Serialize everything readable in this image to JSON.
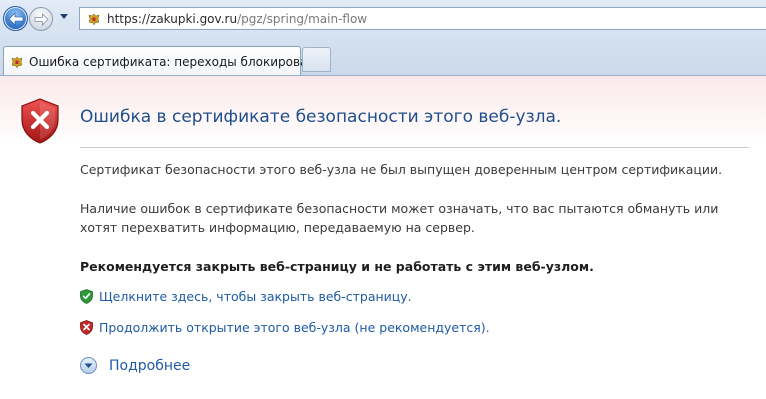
{
  "browser": {
    "url": {
      "host": "https://zakupki.gov.ru",
      "path": "/pgz/spring/main-flow"
    },
    "tab": {
      "label": "Ошибка сертификата: переходы блокированы"
    },
    "icons": {
      "back": "back-arrow-icon",
      "forward": "forward-arrow-icon",
      "dropdown": "chevron-down-icon",
      "favicon": "coat-of-arms-icon"
    }
  },
  "page": {
    "title": "Ошибка в сертификате безопасности этого веб-узла.",
    "paragraph1": "Сертификат безопасности этого веб-узла не был выпущен доверенным центром сертификации.",
    "paragraph2": "Наличие ошибок в сертификате безопасности может означать, что вас пытаются обмануть или хотят перехватить информацию, передаваемую на сервер.",
    "recommendation": "Рекомендуется закрыть веб-страницу и не работать с этим веб-узлом.",
    "actions": {
      "close": "Щелкните здесь, чтобы закрыть веб-страницу.",
      "continue": "Продолжить открытие этого веб-узла (не рекомендуется)."
    },
    "more_info": "Подробнее"
  },
  "colors": {
    "title": "#1f4e8c",
    "link": "#1e5aa8",
    "error_shield": "#c62828",
    "safe_shield": "#2e9b3a"
  }
}
